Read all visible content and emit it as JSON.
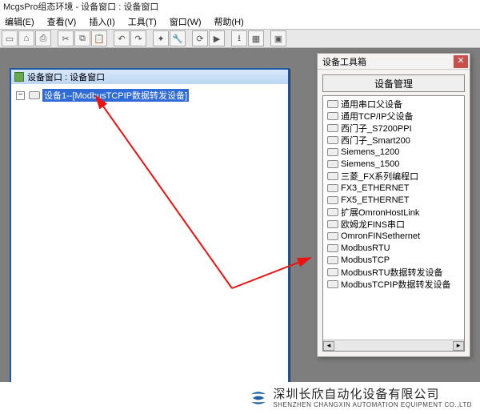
{
  "window": {
    "title": "McgsPro组态环境 - 设备窗口 : 设备窗口"
  },
  "menu": {
    "edit": "编辑(E)",
    "view": "查看(V)",
    "insert": "插入(I)",
    "tools": "工具(T)",
    "window": "窗口(W)",
    "help": "帮助(H)"
  },
  "child_window": {
    "title": "设备窗口 : 设备窗口",
    "tree_root": "设备1--[ModbusTCPIP数据转发设备]"
  },
  "toolbox": {
    "title": "设备工具箱",
    "manage_button": "设备管理",
    "items": [
      "通用串口父设备",
      "通用TCP/IP父设备",
      "西门子_S7200PPI",
      "西门子_Smart200",
      "Siemens_1200",
      "Siemens_1500",
      "三菱_FX系列编程口",
      "FX3_ETHERNET",
      "FX5_ETHERNET",
      "扩展OmronHostLink",
      "欧姆龙FINS串口",
      "OmronFINSethernet",
      "ModbusRTU",
      "ModbusTCP",
      "ModbusRTU数据转发设备",
      "ModbusTCPIP数据转发设备"
    ]
  },
  "branding": {
    "company_cn": "深圳长欣自动化设备有限公司",
    "company_en": "SHENZHEN CHANGXIN AUTOMATION EQUIPMENT CO.,LTD"
  }
}
